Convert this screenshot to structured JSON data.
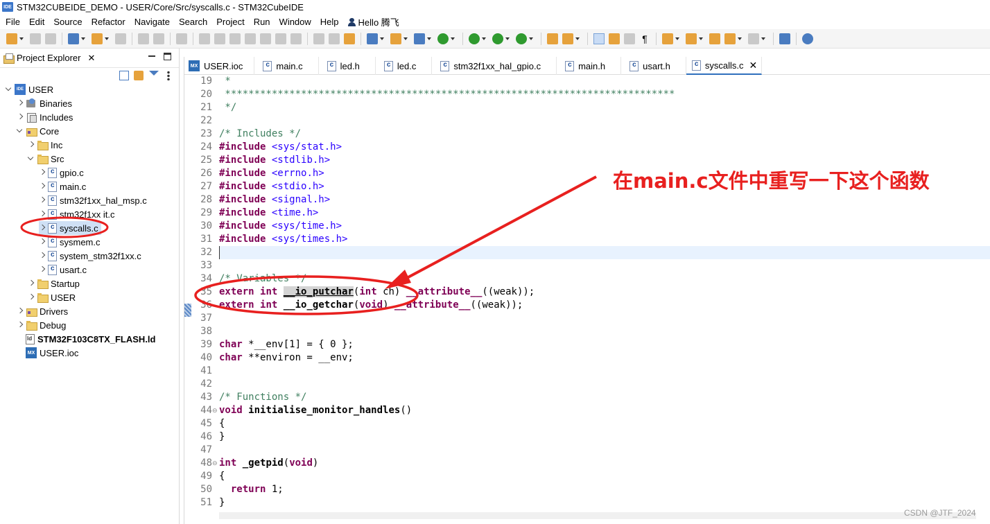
{
  "window": {
    "title": "STM32CUBEIDE_DEMO - USER/Core/Src/syscalls.c - STM32CubeIDE",
    "app_icon": "IDE"
  },
  "menu": [
    "File",
    "Edit",
    "Source",
    "Refactor",
    "Navigate",
    "Search",
    "Project",
    "Run",
    "Window",
    "Help"
  ],
  "user_menu": "Hello 腾飞",
  "explorer": {
    "title": "Project Explorer",
    "close": "✕",
    "tree": [
      {
        "label": "USER",
        "icon": "IDE"
      },
      {
        "label": "Binaries"
      },
      {
        "label": "Includes"
      },
      {
        "label": "Core"
      },
      {
        "label": "Inc"
      },
      {
        "label": "Src"
      },
      {
        "label": "gpio.c"
      },
      {
        "label": "main.c"
      },
      {
        "label": "stm32f1xx_hal_msp.c"
      },
      {
        "label": "stm32f1xx it.c"
      },
      {
        "label": "syscalls.c"
      },
      {
        "label": "sysmem.c"
      },
      {
        "label": "system_stm32f1xx.c"
      },
      {
        "label": "usart.c"
      },
      {
        "label": "Startup"
      },
      {
        "label": "USER"
      },
      {
        "label": "Drivers"
      },
      {
        "label": "Debug"
      },
      {
        "label": "STM32F103C8TX_FLASH.ld"
      },
      {
        "label": "USER.ioc",
        "icon": "MX"
      }
    ]
  },
  "tabs": [
    {
      "label": "USER.ioc",
      "icon": "MX"
    },
    {
      "label": "main.c",
      "icon": "c"
    },
    {
      "label": "led.h",
      "icon": "h"
    },
    {
      "label": "led.c",
      "icon": "c"
    },
    {
      "label": "stm32f1xx_hal_gpio.c",
      "icon": "c"
    },
    {
      "label": "main.h",
      "icon": "h"
    },
    {
      "label": "usart.h",
      "icon": "h"
    },
    {
      "label": "syscalls.c",
      "icon": "c",
      "close": "✕"
    }
  ],
  "code": {
    "line_numbers": [
      "19",
      "20",
      "21",
      "22",
      "23",
      "24",
      "25",
      "26",
      "27",
      "28",
      "29",
      "30",
      "31",
      "32",
      "33",
      "34",
      "35",
      "36",
      "37",
      "38",
      "39",
      "40",
      "41",
      "42",
      "43",
      "44",
      "45",
      "46",
      "47",
      "48",
      "49",
      "50",
      "51"
    ],
    "fold_glyph": "⊖",
    "t": {
      "l19": " *",
      "l20": " *****************************************************************************",
      "l21": " */",
      "l23": "/* Includes */",
      "inc": "#include",
      "h24": "<sys/stat.h>",
      "h25": "<stdlib.h>",
      "h26": "<errno.h>",
      "h27": "<stdio.h>",
      "h28": "<signal.h>",
      "h29": "<time.h>",
      "h30": "<sys/time.h>",
      "h31": "<sys/times.h>",
      "l34": "/* Variables */",
      "extern": "extern",
      "int": "int",
      "putchar": "__io_putchar",
      "p35a": "(",
      "p35b": " ch) ",
      "attr": "__attribute__",
      "weak": "((weak));",
      "getchar": "__io_getchar",
      "p36a": "(",
      "void": "void",
      "p36b": ") ",
      "char": "char",
      "l39": " *__env[1] = { 0 };",
      "l40": " **environ = __env;",
      "l43": "/* Functions */",
      "iface": "initialise_monitor_handles",
      "parens": "()",
      "lbrace": "{",
      "rbrace": "}",
      "getpid": "_getpid",
      "p48": "(",
      "p48b": ")",
      "ret": "return",
      "one": " 1;"
    }
  },
  "annotation": {
    "text": "在main.c文件中重写一下这个函数",
    "color": "#e8201f"
  },
  "watermark": "CSDN @JTF_2024"
}
